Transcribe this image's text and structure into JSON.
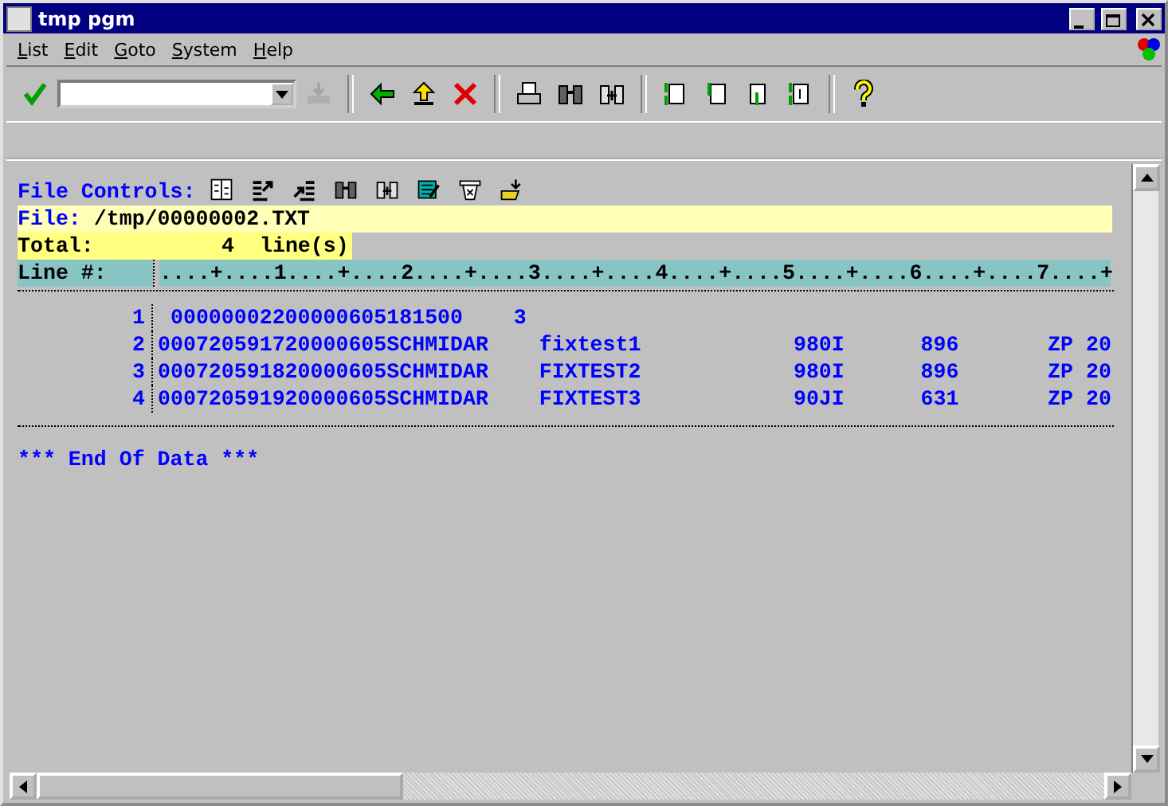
{
  "window": {
    "title": "tmp pgm"
  },
  "menu": [
    {
      "label": "List"
    },
    {
      "label": "Edit"
    },
    {
      "label": "Goto"
    },
    {
      "label": "System"
    },
    {
      "label": "Help"
    }
  ],
  "toolbar": [
    {
      "kind": "enter",
      "disabled": false
    },
    {
      "kind": "command"
    },
    {
      "kind": "save",
      "disabled": true
    },
    {
      "kind": "sep"
    },
    {
      "kind": "back",
      "disabled": false
    },
    {
      "kind": "up",
      "disabled": false
    },
    {
      "kind": "cancel",
      "disabled": false
    },
    {
      "kind": "sep"
    },
    {
      "kind": "print",
      "disabled": false
    },
    {
      "kind": "find",
      "disabled": false
    },
    {
      "kind": "findnext",
      "disabled": false
    },
    {
      "kind": "sep"
    },
    {
      "kind": "first",
      "disabled": false
    },
    {
      "kind": "prev",
      "disabled": false
    },
    {
      "kind": "next",
      "disabled": false
    },
    {
      "kind": "last",
      "disabled": false
    },
    {
      "kind": "sep"
    },
    {
      "kind": "help",
      "disabled": false
    }
  ],
  "list": {
    "controls_label": "File Controls:",
    "controls": [
      {
        "kind": "columns"
      },
      {
        "kind": "expand"
      },
      {
        "kind": "collapse"
      },
      {
        "kind": "find"
      },
      {
        "kind": "findnext"
      },
      {
        "kind": "edit"
      },
      {
        "kind": "delete"
      },
      {
        "kind": "download"
      }
    ],
    "file_label": "File:",
    "file_path": "/tmp/00000002.TXT",
    "total_label": "Total:",
    "total_count": "4",
    "total_unit": "line(s)",
    "line_header": "Line #:",
    "ruler": "....+....1....+....2....+....3....+....4....+....5....+....6....+....7....+",
    "rows": [
      {
        "number": "1",
        "text": " 00000002200000605181500    3"
      },
      {
        "number": "2",
        "text": "000720591720000605SCHMIDAR    fixtest1            980I      896       ZP 20"
      },
      {
        "number": "3",
        "text": "000720591820000605SCHMIDAR    FIXTEST2            980I      896       ZP 20"
      },
      {
        "number": "4",
        "text": "000720591920000605SCHMIDAR    FIXTEST3            90JI      631       ZP 20"
      }
    ],
    "end_text": "*** End Of Data ***"
  }
}
